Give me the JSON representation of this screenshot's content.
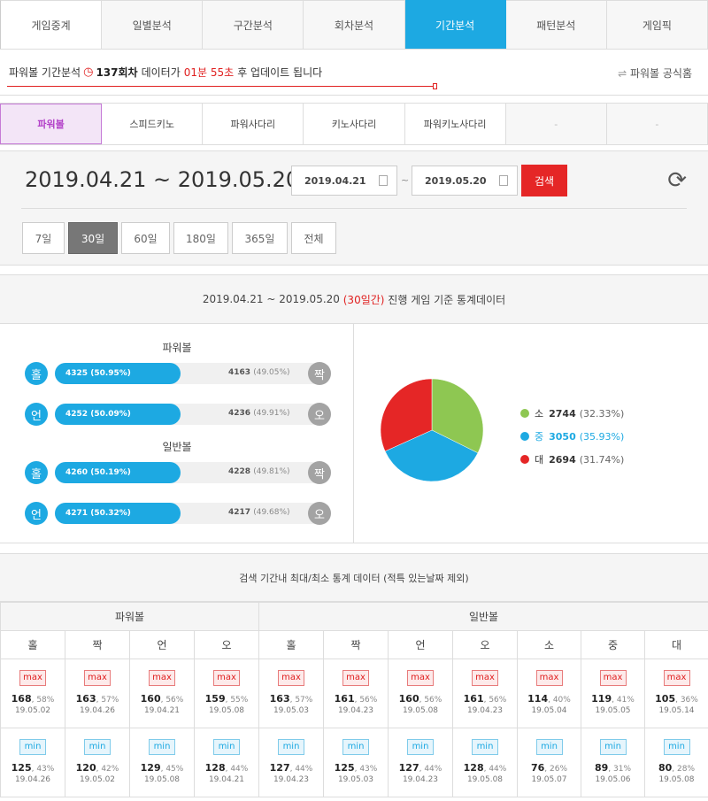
{
  "nav": {
    "tabs": [
      {
        "label": "게임중계"
      },
      {
        "label": "일별분석"
      },
      {
        "label": "구간분석"
      },
      {
        "label": "회차분석"
      },
      {
        "label": "기간분석"
      },
      {
        "label": "패턴분석"
      },
      {
        "label": "게임픽"
      }
    ],
    "active": "기간분석"
  },
  "info": {
    "prefix": "파워볼 기간분석",
    "round": "137회차",
    "mid": "데이터가",
    "time": "01분 55초",
    "suffix": "후 업데이트 됩니다",
    "homepage": "파워볼 공식홈"
  },
  "games": {
    "tabs": [
      {
        "label": "파워볼"
      },
      {
        "label": "스피드키노"
      },
      {
        "label": "파워사다리"
      },
      {
        "label": "키노사다리"
      },
      {
        "label": "파워키노사다리"
      },
      {
        "label": "-"
      },
      {
        "label": "-"
      }
    ],
    "active": "파워볼"
  },
  "dates": {
    "title": "2019.04.21 ~ 2019.05.20",
    "start": "2019.04.21",
    "end": "2019.05.20",
    "tilde": "~",
    "search": "검색",
    "periods": [
      {
        "label": "7일"
      },
      {
        "label": "30일"
      },
      {
        "label": "60일"
      },
      {
        "label": "180일"
      },
      {
        "label": "365일"
      },
      {
        "label": "전체"
      }
    ],
    "active_period": "30일"
  },
  "stats": {
    "head_range": "2019.04.21 ~ 2019.05.20",
    "head_days": "(30일간)",
    "head_suffix": "진행 게임 기준 통계데이터",
    "powerball_title": "파워볼",
    "normal_title": "일반볼",
    "rows": [
      {
        "left_label": "홀",
        "left_value": "4325",
        "left_pct": "(50.95%)",
        "right_value": "4163",
        "right_pct": "(49.05%)",
        "right_label": "짝",
        "fill_fraction": 0.4695
      },
      {
        "left_label": "언",
        "left_value": "4252",
        "left_pct": "(50.09%)",
        "right_value": "4236",
        "right_pct": "(49.91%)",
        "right_label": "오",
        "fill_fraction": 0.4695
      },
      {
        "left_label": "홀",
        "left_value": "4260",
        "left_pct": "(50.19%)",
        "right_value": "4228",
        "right_pct": "(49.81%)",
        "right_label": "짝",
        "fill_fraction": 0.4695
      },
      {
        "left_label": "언",
        "left_value": "4271",
        "left_pct": "(50.32%)",
        "right_value": "4217",
        "right_pct": "(49.68%)",
        "right_label": "오",
        "fill_fraction": 0.4695
      }
    ],
    "pie": [
      {
        "label": "소",
        "value": "2744",
        "pct": "(32.33%)",
        "color": "#8ec752",
        "fraction": 0.3233
      },
      {
        "label": "중",
        "value": "3050",
        "pct": "(35.93%)",
        "color": "#1da9e2",
        "fraction": 0.3593
      },
      {
        "label": "대",
        "value": "2694",
        "pct": "(31.74%)",
        "color": "#e52626",
        "fraction": 0.3174
      }
    ]
  },
  "extreme": {
    "title": "검색 기간내 최대/최소 통계 데이터 (적특 있는날짜 제외)",
    "groups": [
      {
        "label": "파워볼"
      },
      {
        "label": "일반볼"
      }
    ],
    "cols": [
      "홀",
      "짝",
      "언",
      "오",
      "홀",
      "짝",
      "언",
      "오",
      "소",
      "중",
      "대"
    ],
    "max_tag": "max",
    "min_tag": "min",
    "max": [
      {
        "v": "168",
        "p": ", 58%",
        "d": "19.05.02"
      },
      {
        "v": "163",
        "p": ", 57%",
        "d": "19.04.26"
      },
      {
        "v": "160",
        "p": ", 56%",
        "d": "19.04.21"
      },
      {
        "v": "159",
        "p": ", 55%",
        "d": "19.05.08"
      },
      {
        "v": "163",
        "p": ", 57%",
        "d": "19.05.03"
      },
      {
        "v": "161",
        "p": ", 56%",
        "d": "19.04.23"
      },
      {
        "v": "160",
        "p": ", 56%",
        "d": "19.05.08"
      },
      {
        "v": "161",
        "p": ", 56%",
        "d": "19.04.23"
      },
      {
        "v": "114",
        "p": ", 40%",
        "d": "19.05.04"
      },
      {
        "v": "119",
        "p": ", 41%",
        "d": "19.05.05"
      },
      {
        "v": "105",
        "p": ", 36%",
        "d": "19.05.14"
      }
    ],
    "min": [
      {
        "v": "125",
        "p": ", 43%",
        "d": "19.04.26"
      },
      {
        "v": "120",
        "p": ", 42%",
        "d": "19.05.02"
      },
      {
        "v": "129",
        "p": ", 45%",
        "d": "19.05.08"
      },
      {
        "v": "128",
        "p": ", 44%",
        "d": "19.04.21"
      },
      {
        "v": "127",
        "p": ", 44%",
        "d": "19.04.23"
      },
      {
        "v": "125",
        "p": ", 43%",
        "d": "19.05.03"
      },
      {
        "v": "127",
        "p": ", 44%",
        "d": "19.04.23"
      },
      {
        "v": "128",
        "p": ", 44%",
        "d": "19.05.08"
      },
      {
        "v": "76",
        "p": ", 26%",
        "d": "19.05.07"
      },
      {
        "v": "89",
        "p": ", 31%",
        "d": "19.05.06"
      },
      {
        "v": "80",
        "p": ", 28%",
        "d": "19.05.08"
      }
    ]
  }
}
